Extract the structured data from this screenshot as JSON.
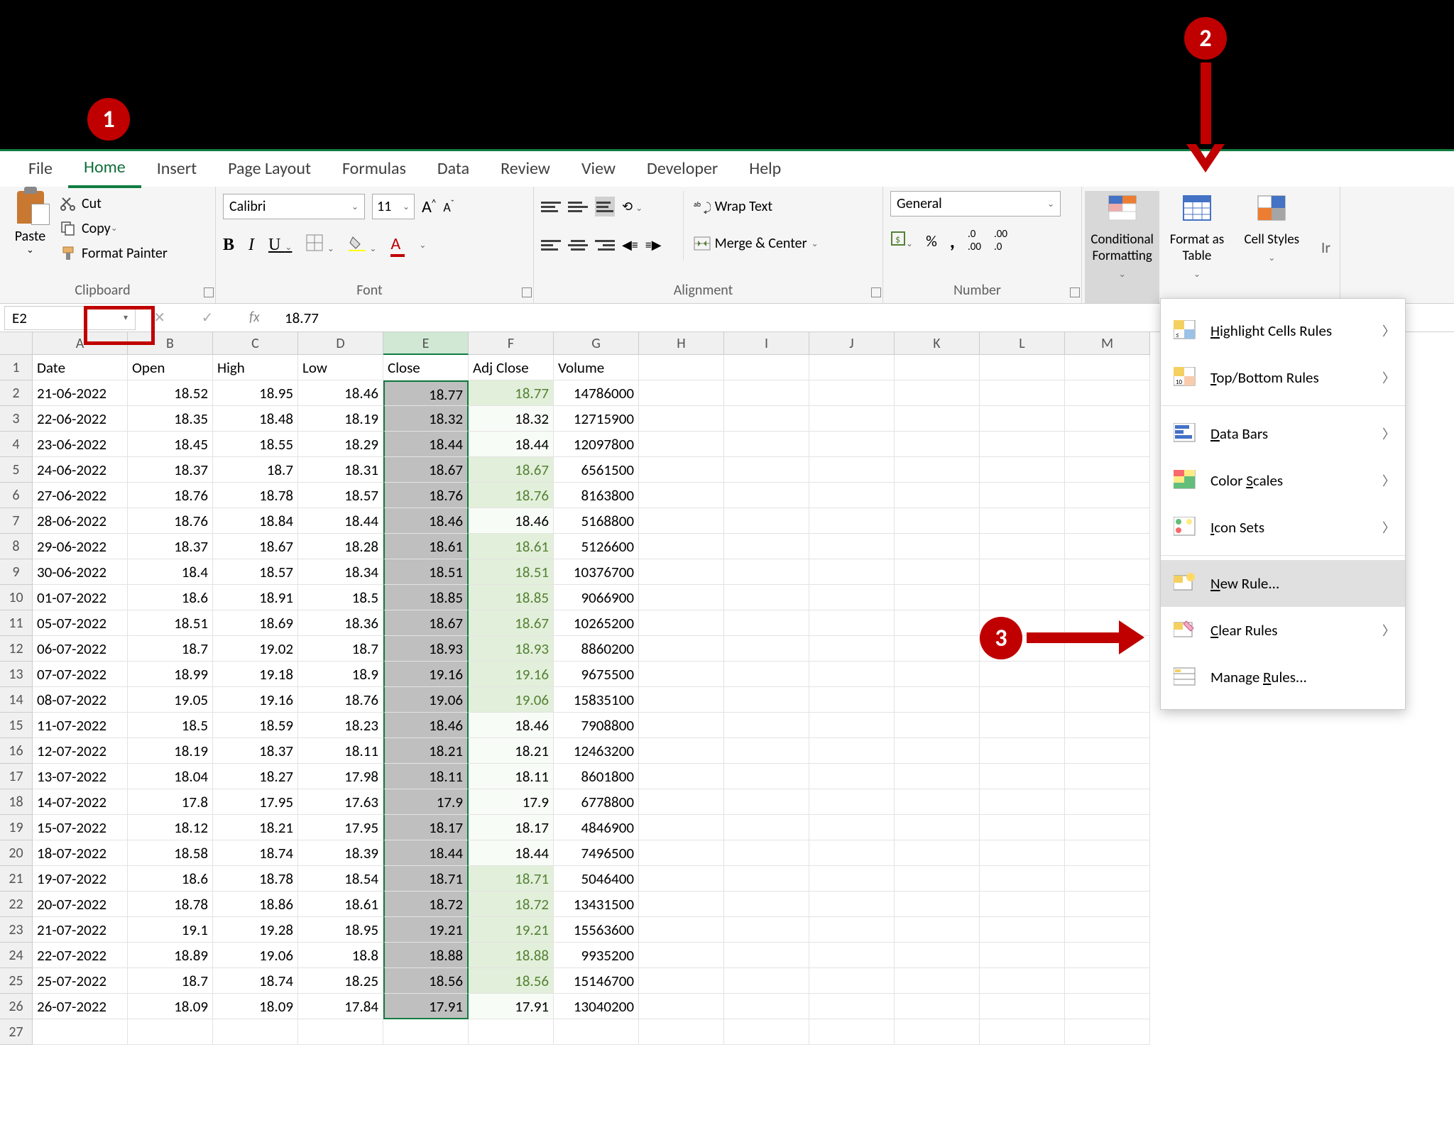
{
  "tabs": [
    "File",
    "Home",
    "Insert",
    "Page Layout",
    "Formulas",
    "Data",
    "Review",
    "View",
    "Developer",
    "Help"
  ],
  "active_tab": "Home",
  "clipboard": {
    "paste": "Paste",
    "cut": "Cut",
    "copy": "Copy",
    "painter": "Format Painter",
    "label": "Clipboard"
  },
  "font": {
    "name": "Calibri",
    "size": "11",
    "label": "Font"
  },
  "alignment": {
    "wrap": "Wrap Text",
    "merge": "Merge & Center",
    "label": "Alignment"
  },
  "number": {
    "format": "General",
    "label": "Number"
  },
  "styles": {
    "cf": "Conditional Formatting",
    "table": "Format as Table",
    "cell": "Cell Styles"
  },
  "name_box": "E2",
  "formula": "18.77",
  "columns": [
    "A",
    "B",
    "C",
    "D",
    "E",
    "F",
    "G",
    "H",
    "I",
    "J",
    "K",
    "L",
    "M"
  ],
  "headers": [
    "Date",
    "Open",
    "High",
    "Low",
    "Close",
    "Adj Close",
    "Volume"
  ],
  "rows": [
    {
      "date": "21-06-2022",
      "open": "18.52",
      "high": "18.95",
      "low": "18.46",
      "close": "18.77",
      "adj": "18.77",
      "adj_g": true,
      "vol": "14786000"
    },
    {
      "date": "22-06-2022",
      "open": "18.35",
      "high": "18.48",
      "low": "18.19",
      "close": "18.32",
      "adj": "18.32",
      "adj_g": false,
      "vol": "12715900"
    },
    {
      "date": "23-06-2022",
      "open": "18.45",
      "high": "18.55",
      "low": "18.29",
      "close": "18.44",
      "adj": "18.44",
      "adj_g": false,
      "vol": "12097800"
    },
    {
      "date": "24-06-2022",
      "open": "18.37",
      "high": "18.7",
      "low": "18.31",
      "close": "18.67",
      "adj": "18.67",
      "adj_g": true,
      "vol": "6561500"
    },
    {
      "date": "27-06-2022",
      "open": "18.76",
      "high": "18.78",
      "low": "18.57",
      "close": "18.76",
      "adj": "18.76",
      "adj_g": true,
      "vol": "8163800"
    },
    {
      "date": "28-06-2022",
      "open": "18.76",
      "high": "18.84",
      "low": "18.44",
      "close": "18.46",
      "adj": "18.46",
      "adj_g": false,
      "vol": "5168800"
    },
    {
      "date": "29-06-2022",
      "open": "18.37",
      "high": "18.67",
      "low": "18.28",
      "close": "18.61",
      "adj": "18.61",
      "adj_g": true,
      "vol": "5126600"
    },
    {
      "date": "30-06-2022",
      "open": "18.4",
      "high": "18.57",
      "low": "18.34",
      "close": "18.51",
      "adj": "18.51",
      "adj_g": true,
      "vol": "10376700"
    },
    {
      "date": "01-07-2022",
      "open": "18.6",
      "high": "18.91",
      "low": "18.5",
      "close": "18.85",
      "adj": "18.85",
      "adj_g": true,
      "vol": "9066900"
    },
    {
      "date": "05-07-2022",
      "open": "18.51",
      "high": "18.69",
      "low": "18.36",
      "close": "18.67",
      "adj": "18.67",
      "adj_g": true,
      "vol": "10265200"
    },
    {
      "date": "06-07-2022",
      "open": "18.7",
      "high": "19.02",
      "low": "18.7",
      "close": "18.93",
      "adj": "18.93",
      "adj_g": true,
      "vol": "8860200"
    },
    {
      "date": "07-07-2022",
      "open": "18.99",
      "high": "19.18",
      "low": "18.9",
      "close": "19.16",
      "adj": "19.16",
      "adj_g": true,
      "vol": "9675500"
    },
    {
      "date": "08-07-2022",
      "open": "19.05",
      "high": "19.16",
      "low": "18.76",
      "close": "19.06",
      "adj": "19.06",
      "adj_g": true,
      "vol": "15835100"
    },
    {
      "date": "11-07-2022",
      "open": "18.5",
      "high": "18.59",
      "low": "18.23",
      "close": "18.46",
      "adj": "18.46",
      "adj_g": false,
      "vol": "7908800"
    },
    {
      "date": "12-07-2022",
      "open": "18.19",
      "high": "18.37",
      "low": "18.11",
      "close": "18.21",
      "adj": "18.21",
      "adj_g": false,
      "vol": "12463200"
    },
    {
      "date": "13-07-2022",
      "open": "18.04",
      "high": "18.27",
      "low": "17.98",
      "close": "18.11",
      "adj": "18.11",
      "adj_g": false,
      "vol": "8601800"
    },
    {
      "date": "14-07-2022",
      "open": "17.8",
      "high": "17.95",
      "low": "17.63",
      "close": "17.9",
      "adj": "17.9",
      "adj_g": false,
      "vol": "6778800"
    },
    {
      "date": "15-07-2022",
      "open": "18.12",
      "high": "18.21",
      "low": "17.95",
      "close": "18.17",
      "adj": "18.17",
      "adj_g": false,
      "vol": "4846900"
    },
    {
      "date": "18-07-2022",
      "open": "18.58",
      "high": "18.74",
      "low": "18.39",
      "close": "18.44",
      "adj": "18.44",
      "adj_g": false,
      "vol": "7496500"
    },
    {
      "date": "19-07-2022",
      "open": "18.6",
      "high": "18.78",
      "low": "18.54",
      "close": "18.71",
      "adj": "18.71",
      "adj_g": true,
      "vol": "5046400"
    },
    {
      "date": "20-07-2022",
      "open": "18.78",
      "high": "18.86",
      "low": "18.61",
      "close": "18.72",
      "adj": "18.72",
      "adj_g": true,
      "vol": "13431500"
    },
    {
      "date": "21-07-2022",
      "open": "19.1",
      "high": "19.28",
      "low": "18.95",
      "close": "19.21",
      "adj": "19.21",
      "adj_g": true,
      "vol": "15563600"
    },
    {
      "date": "22-07-2022",
      "open": "18.89",
      "high": "19.06",
      "low": "18.8",
      "close": "18.88",
      "adj": "18.88",
      "adj_g": true,
      "vol": "9935200"
    },
    {
      "date": "25-07-2022",
      "open": "18.7",
      "high": "18.74",
      "low": "18.25",
      "close": "18.56",
      "adj": "18.56",
      "adj_g": true,
      "vol": "15146700"
    },
    {
      "date": "26-07-2022",
      "open": "18.09",
      "high": "18.09",
      "low": "17.84",
      "close": "17.91",
      "adj": "17.91",
      "adj_g": false,
      "vol": "13040200"
    }
  ],
  "cf_menu": {
    "highlight": "Highlight Cells Rules",
    "topbottom": "Top/Bottom Rules",
    "databars": "Data Bars",
    "colorscales": "Color Scales",
    "iconsets": "Icon Sets",
    "newrule": "New Rule...",
    "clear": "Clear Rules",
    "manage": "Manage Rules..."
  },
  "callouts": {
    "c1": "1",
    "c2": "2",
    "c3": "3"
  }
}
